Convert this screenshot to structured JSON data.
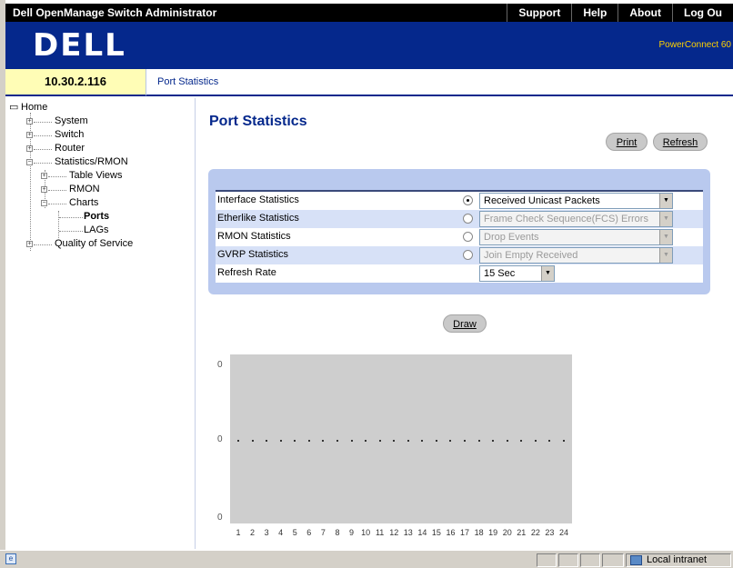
{
  "topbar": {
    "title": "Dell OpenManage Switch Administrator",
    "links": [
      "Support",
      "Help",
      "About",
      "Log Ou"
    ]
  },
  "brand": {
    "logo": "DELL",
    "model": "PowerConnect 60"
  },
  "ip_address": "10.30.2.116",
  "breadcrumb": "Port Statistics",
  "sidebar": {
    "items": [
      {
        "label": "Home"
      },
      {
        "label": "System"
      },
      {
        "label": "Switch"
      },
      {
        "label": "Router"
      },
      {
        "label": "Statistics/RMON"
      },
      {
        "label": "Table Views"
      },
      {
        "label": "RMON"
      },
      {
        "label": "Charts"
      },
      {
        "label": "Ports"
      },
      {
        "label": "LAGs"
      },
      {
        "label": "Quality of Service"
      }
    ]
  },
  "main": {
    "title": "Port Statistics",
    "print_label": "Print",
    "refresh_label": "Refresh",
    "draw_label": "Draw",
    "form": {
      "rows": [
        {
          "label": "Interface Statistics",
          "selected": true,
          "value": "Received Unicast Packets"
        },
        {
          "label": "Etherlike Statistics",
          "selected": false,
          "value": "Frame Check Sequence(FCS) Errors"
        },
        {
          "label": "RMON Statistics",
          "selected": false,
          "value": "Drop Events"
        },
        {
          "label": "GVRP Statistics",
          "selected": false,
          "value": "Join Empty Received"
        }
      ],
      "refresh_rate_label": "Refresh Rate",
      "refresh_rate_value": "15 Sec"
    }
  },
  "chart_data": {
    "type": "line",
    "title": "",
    "xlabel": "",
    "ylabel": "",
    "y_tick_labels": [
      "0",
      "0",
      "0"
    ],
    "categories": [
      "1",
      "2",
      "3",
      "4",
      "5",
      "6",
      "7",
      "8",
      "9",
      "10",
      "11",
      "12",
      "13",
      "14",
      "15",
      "16",
      "17",
      "18",
      "19",
      "20",
      "21",
      "22",
      "23",
      "24"
    ],
    "values": [
      0,
      0,
      0,
      0,
      0,
      0,
      0,
      0,
      0,
      0,
      0,
      0,
      0,
      0,
      0,
      0,
      0,
      0,
      0,
      0,
      0,
      0,
      0,
      0
    ],
    "ylim": [
      0,
      0
    ],
    "grid": false,
    "background": "#cecece"
  },
  "statusbar": {
    "zone": "Local intranet"
  },
  "colors": {
    "brand_blue": "#05288c",
    "ip_bg": "#fffdb6",
    "panel_bg": "#b9c9ee"
  }
}
